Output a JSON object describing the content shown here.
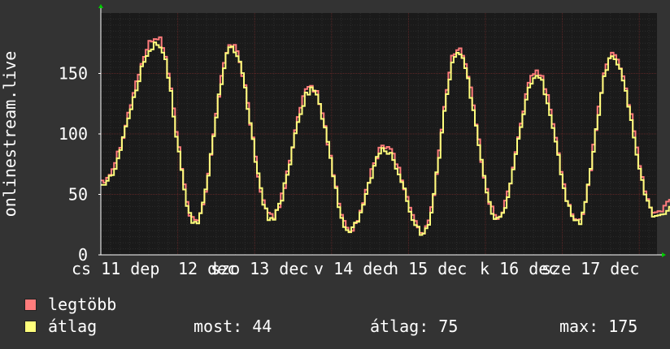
{
  "chart_data": {
    "type": "line",
    "ylabel": "onlinestream.live",
    "ylim": [
      0,
      200
    ],
    "y_ticks": [
      "0",
      "50",
      "100",
      "150"
    ],
    "x_tick_labels": [
      "cs 11 dep",
      "12 dec",
      "szo 13 dec",
      "v 14 dec",
      "h 15 dec",
      "k 16 dec",
      "sze 17 dec"
    ],
    "grid": true,
    "series": [
      {
        "name": "legtöbb",
        "color": "#ff7c7c",
        "peaks": [
          {
            "day": 0.72,
            "value": 180
          },
          {
            "day": 1.69,
            "value": 174
          },
          {
            "day": 2.72,
            "value": 139
          },
          {
            "day": 3.68,
            "value": 91
          },
          {
            "day": 4.62,
            "value": 171
          },
          {
            "day": 5.65,
            "value": 151
          },
          {
            "day": 6.63,
            "value": 167
          }
        ],
        "troughs": [
          {
            "day": 0.0,
            "value": 62
          },
          {
            "day": 1.21,
            "value": 27
          },
          {
            "day": 2.2,
            "value": 31
          },
          {
            "day": 3.22,
            "value": 21
          },
          {
            "day": 4.18,
            "value": 19
          },
          {
            "day": 5.14,
            "value": 31
          },
          {
            "day": 6.18,
            "value": 27
          },
          {
            "day": 7.2,
            "value": 34
          },
          {
            "day": 7.46,
            "value": 47
          }
        ]
      },
      {
        "name": "átlag",
        "color": "#ffff7c",
        "peaks": [
          {
            "day": 0.72,
            "value": 175
          },
          {
            "day": 1.69,
            "value": 171
          },
          {
            "day": 2.72,
            "value": 136
          },
          {
            "day": 3.68,
            "value": 87
          },
          {
            "day": 4.62,
            "value": 166
          },
          {
            "day": 5.65,
            "value": 147
          },
          {
            "day": 6.63,
            "value": 162
          }
        ],
        "troughs": [
          {
            "day": 0.0,
            "value": 58
          },
          {
            "day": 1.21,
            "value": 26
          },
          {
            "day": 2.2,
            "value": 30
          },
          {
            "day": 3.22,
            "value": 20
          },
          {
            "day": 4.18,
            "value": 18
          },
          {
            "day": 5.14,
            "value": 30
          },
          {
            "day": 6.18,
            "value": 26
          },
          {
            "day": 7.2,
            "value": 32
          },
          {
            "day": 7.46,
            "value": 44
          }
        ]
      }
    ]
  },
  "legend": {
    "max_label": "legtöbb",
    "avg_label": "átlag",
    "now_text": "most: 44",
    "avg_text": "átlag: 75",
    "max_text": "max: 175"
  }
}
